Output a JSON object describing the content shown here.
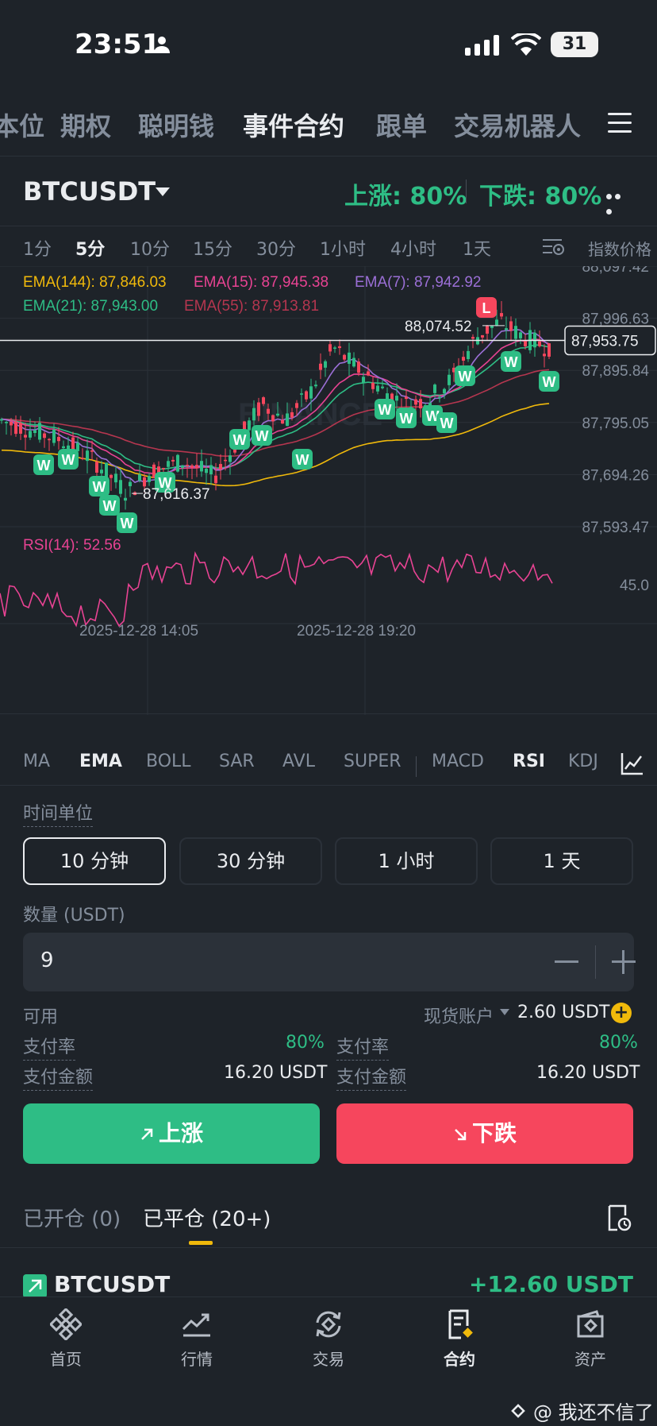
{
  "status_bar": {
    "time": "23:51",
    "battery": "31"
  },
  "top_nav": {
    "tabs": [
      {
        "label": "本位"
      },
      {
        "label": "期权"
      },
      {
        "label": "聪明钱"
      },
      {
        "label": "事件合约"
      },
      {
        "label": "跟单"
      },
      {
        "label": "交易机器人"
      }
    ]
  },
  "symbol": {
    "name": "BTCUSDT",
    "up_rate": "上涨: 80%",
    "down_rate": "下跌: 80%"
  },
  "intervals": [
    "1分",
    "5分",
    "10分",
    "15分",
    "30分",
    "1小时",
    "4小时",
    "1天"
  ],
  "index_price_label": "指数价格",
  "chart_data": {
    "type": "candlestick",
    "ema_labels": [
      {
        "text": "EMA(144): 87,846.03",
        "color": "#f0b90b"
      },
      {
        "text": "EMA(15): 87,945.38",
        "color": "#e84393"
      },
      {
        "text": "EMA(7): 87,942.92",
        "color": "#9b6fd6"
      },
      {
        "text": "EMA(21): 87,943.00",
        "color": "#2ebd85"
      },
      {
        "text": "EMA(55): 87,913.81",
        "color": "#b5364f"
      }
    ],
    "y_ticks": [
      "88,097.42",
      "87,996.63",
      "87,895.84",
      "87,795.05",
      "87,694.26",
      "87,593.47"
    ],
    "y_tick_values": [
      88097.42,
      87996.63,
      87895.84,
      87795.05,
      87694.26,
      87593.47
    ],
    "current_price": "87,953.75",
    "current_price_value": 87953.75,
    "high_label": "88,074.52",
    "high_value": 88074.52,
    "low_label": "87,616.37",
    "low_value": 87616.37,
    "x_labels": [
      "2025-12-28 14:05",
      "2025-12-28 19:20"
    ],
    "rsi_label": "RSI(14): 52.56",
    "rsi_tick": "45.0",
    "markers": [
      "W",
      "W",
      "W",
      "W",
      "W",
      "W",
      "W",
      "W",
      "W",
      "W",
      "W",
      "W",
      "W",
      "W",
      "W",
      "L"
    ],
    "watermark": "BINANCE"
  },
  "indicators": {
    "main": [
      "MA",
      "EMA",
      "BOLL",
      "SAR",
      "AVL",
      "SUPER"
    ],
    "sub": [
      "MACD",
      "RSI",
      "KDJ"
    ]
  },
  "form": {
    "time_unit_label": "时间单位",
    "time_options": [
      "10 分钟",
      "30 分钟",
      "1 小时",
      "1 天"
    ],
    "quantity_label": "数量 (USDT)",
    "quantity_value": "9",
    "available_label": "可用",
    "account_label": "现货账户",
    "balance": "2.60 USDT",
    "left": {
      "rate_label": "支付率",
      "rate_value": "80%",
      "amount_label": "支付金额",
      "amount_value": "16.20 USDT"
    },
    "right": {
      "rate_label": "支付率",
      "rate_value": "80%",
      "amount_label": "支付金额",
      "amount_value": "16.20 USDT"
    },
    "up_button": "上涨",
    "down_button": "下跌"
  },
  "positions": {
    "open_tab": "已开仓 (0)",
    "closed_tab": "已平仓 (20+)",
    "item_symbol": "BTCUSDT",
    "item_pnl": "+12.60 USDT"
  },
  "bottom_nav": [
    {
      "label": "首页"
    },
    {
      "label": "行情"
    },
    {
      "label": "交易"
    },
    {
      "label": "合约"
    },
    {
      "label": "资产"
    }
  ],
  "watermark": "@ 我还不信了"
}
